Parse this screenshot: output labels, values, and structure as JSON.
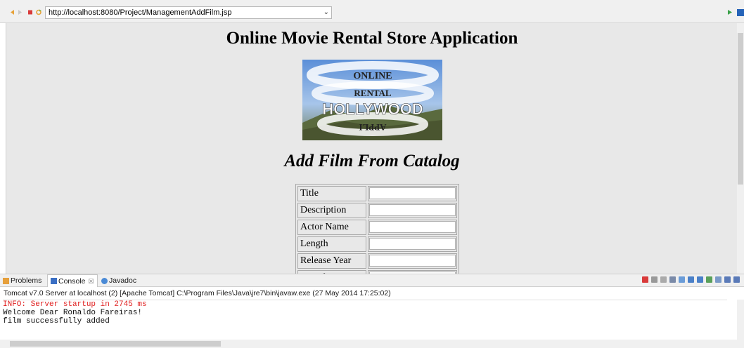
{
  "browser": {
    "url": "http://localhost:8080/Project/ManagementAddFilm.jsp",
    "url_dropdown_glyph": "⌄"
  },
  "page": {
    "title": "Online Movie Rental Store Application",
    "logo_text": "ONLINE RENTAL APPLI HOLLYWOOD",
    "subtitle": "Add Film From Catalog",
    "form_fields": [
      {
        "label": "Title",
        "value": ""
      },
      {
        "label": "Description",
        "value": ""
      },
      {
        "label": "Actor Name",
        "value": ""
      },
      {
        "label": "Length",
        "value": ""
      },
      {
        "label": "Release Year",
        "value": ""
      },
      {
        "label": "Rental Duration",
        "value": ""
      }
    ]
  },
  "panel": {
    "tabs": [
      "Problems",
      "Console",
      "Javadoc"
    ],
    "tab_close": "☒",
    "description": "Tomcat v7.0 Server at localhost (2) [Apache Tomcat] C:\\Program Files\\Java\\jre7\\bin\\javaw.exe (27 May 2014 17:25:02)",
    "output": [
      "INFO: Server startup in 2745 ms",
      "Welcome Dear Ronaldo Fareiras!",
      "film successfully added"
    ]
  },
  "colors": {
    "page_bg": "#e8e8e8",
    "error_text": "#e02020",
    "stop_red": "#d93a3a",
    "run_green": "#3aa048"
  }
}
